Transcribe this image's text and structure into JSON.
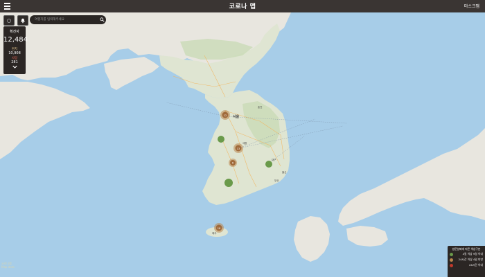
{
  "header": {
    "title": "코로나 맵",
    "mask_link": "마스크맵"
  },
  "search": {
    "placeholder": "여행지를 입력해주세요"
  },
  "stats": {
    "label": "확진자",
    "total": "12,484",
    "recovered_label": "완치",
    "recovered_value": "10,908",
    "death_label": "사망",
    "death_value": "281"
  },
  "legend": {
    "title": "방문날짜에 따른 색상구분",
    "items": [
      {
        "label": "4일 이상 9일 이내",
        "color": "#6a9a4a"
      },
      {
        "label": "24시간 이상 4일 미만",
        "color": "#b9874e"
      },
      {
        "label": "24시간 이내",
        "color": "#c0392b"
      }
    ]
  },
  "map": {
    "place_labels": [
      "서울",
      "춘천",
      "세종",
      "대구",
      "울산",
      "부산",
      "제주"
    ],
    "markers": [
      {
        "label": "12",
        "type": "brown"
      },
      {
        "label": "13",
        "type": "brown"
      },
      {
        "label": "6",
        "type": "brown"
      },
      {
        "label": "",
        "type": "green"
      },
      {
        "label": "",
        "type": "green"
      },
      {
        "label": "",
        "type": "green"
      },
      {
        "label": "18",
        "type": "brown"
      }
    ],
    "colors": {
      "sea": "#a7cde8",
      "land": "#e6e4dc",
      "green_land": "#cfdcbf"
    }
  },
  "credit": {
    "line1": "코로나맵",
    "line2": "Map data"
  }
}
